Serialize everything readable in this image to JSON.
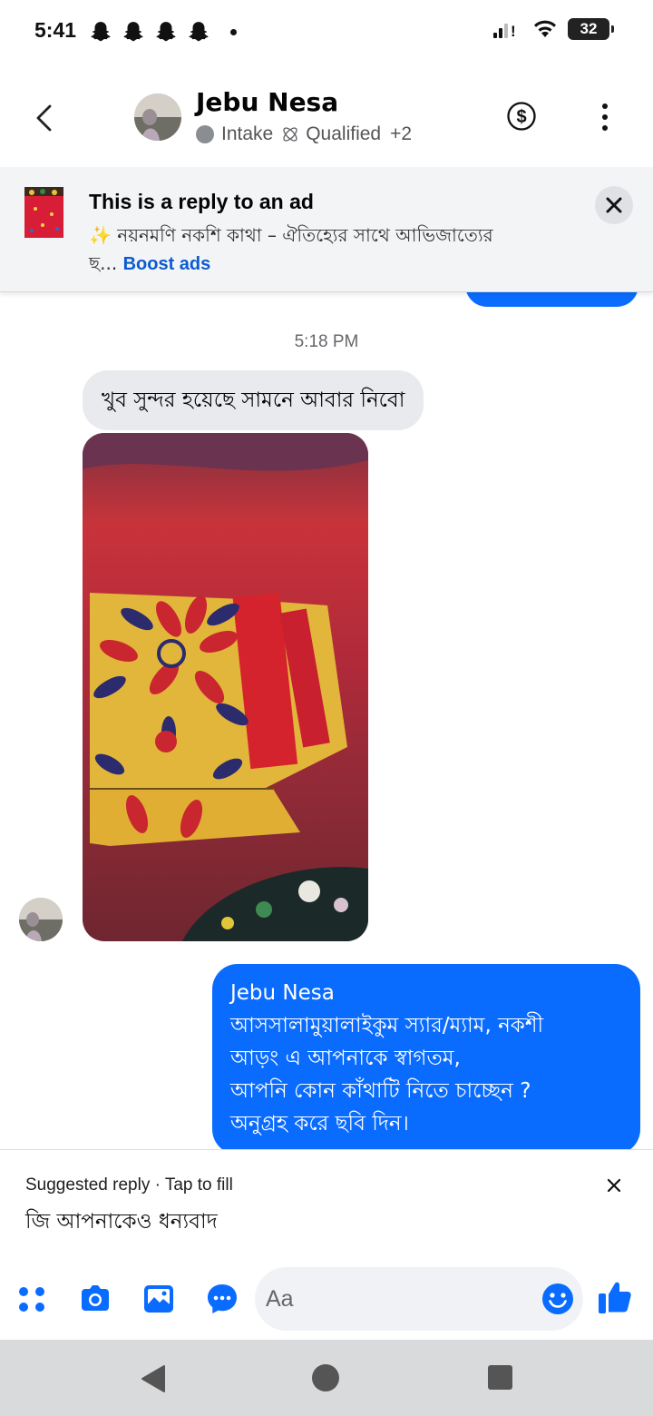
{
  "status_bar": {
    "time": "5:41",
    "battery": "32",
    "icons": [
      "snapchat-icon",
      "snapchat-icon",
      "snapchat-icon",
      "snapchat-icon",
      "signal-icon",
      "wifi-icon",
      "battery-icon"
    ]
  },
  "header": {
    "name": "Jebu Nesa",
    "label_1": "Intake",
    "label_2": "Qualified",
    "label_more": "+2"
  },
  "ad_banner": {
    "title": "This is a reply to an ad",
    "body_line1": "✨ নয়নমণি নকশি কাথা – ঐতিহ্যের সাথে আভিজাত্যের",
    "body_line2": "ছ...",
    "boost_link": "Boost ads"
  },
  "conversation": {
    "timestamp": "5:18 PM",
    "incoming_text": "খুব সুন্দর হয়েছে সামনে আবার নিবো",
    "outgoing_lines": [
      "Jebu Nesa",
      "আসসালামুয়ালাইকুম স্যার/ম্যাম, নকশী",
      "আড়ং এ আপনাকে স্বাগতম,",
      "আপনি কোন কাঁথাটি নিতে চাচ্ছেন ?",
      "অনুগ্রহ করে ছবি দিন।"
    ]
  },
  "suggested_reply": {
    "label": "Suggested reply · Tap to fill",
    "text": "জি আপনাকেও ধন্যবাদ"
  },
  "composer": {
    "placeholder": "Aa"
  },
  "colors": {
    "accent": "#0a6cff",
    "incoming_bubble": "#e9eaed",
    "link": "#0a5bd3"
  }
}
